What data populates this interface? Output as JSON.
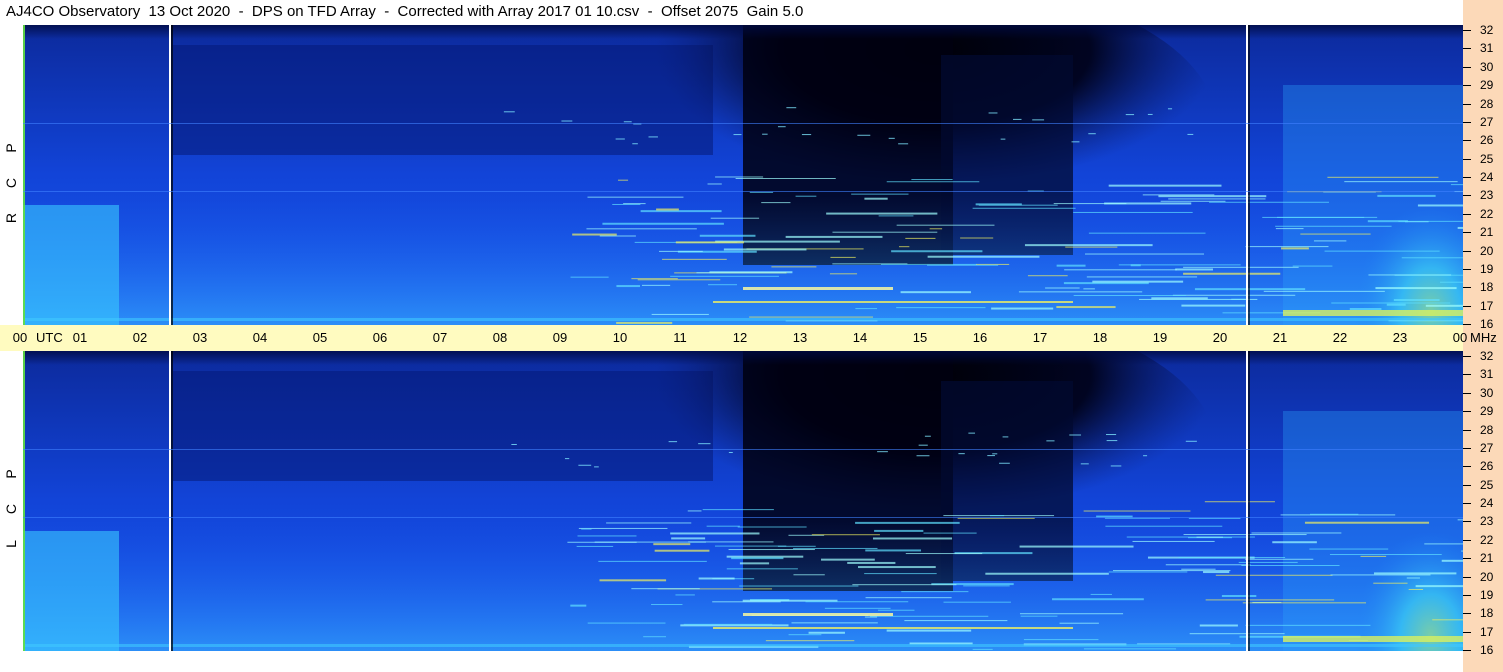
{
  "title": "AJ4CO Observatory  13 Oct 2020  -  DPS on TFD Array  -  Corrected with Array 2017 01 10.csv  -  Offset 2075  Gain 5.0",
  "chart_data": {
    "type": "heatmap",
    "title": "AJ4CO Observatory  13 Oct 2020  -  DPS on TFD Array  -  Corrected with Array 2017 01 10.csv  -  Offset 2075  Gain 5.0",
    "x_axis": {
      "label": "UTC",
      "ticks": [
        "00",
        "01",
        "02",
        "03",
        "04",
        "05",
        "06",
        "07",
        "08",
        "09",
        "10",
        "11",
        "12",
        "13",
        "14",
        "15",
        "16",
        "17",
        "18",
        "19",
        "20",
        "21",
        "22",
        "23",
        "00"
      ],
      "range_hours": [
        0,
        24
      ]
    },
    "y_axis": {
      "unit": "MHz",
      "ticks": [
        "32",
        "31",
        "30",
        "29",
        "28",
        "27",
        "26",
        "25",
        "24",
        "23",
        "22",
        "21",
        "20",
        "19",
        "18",
        "17",
        "16"
      ],
      "range": [
        16,
        32
      ]
    },
    "panels": [
      {
        "name": "RCP",
        "letters": [
          "R",
          "C",
          "P"
        ]
      },
      {
        "name": "LCP",
        "letters": [
          "L",
          "C",
          "P"
        ]
      }
    ],
    "markers_utc": [
      2.45,
      20.4
    ],
    "colors": {
      "background_blue": "#1040d8",
      "dark": "#000010",
      "low_band_cyan": "#40c0ff",
      "hot_yellow": "#f0f060"
    }
  },
  "axis": {
    "utc_label": "UTC",
    "mhz_label": "MHz"
  }
}
